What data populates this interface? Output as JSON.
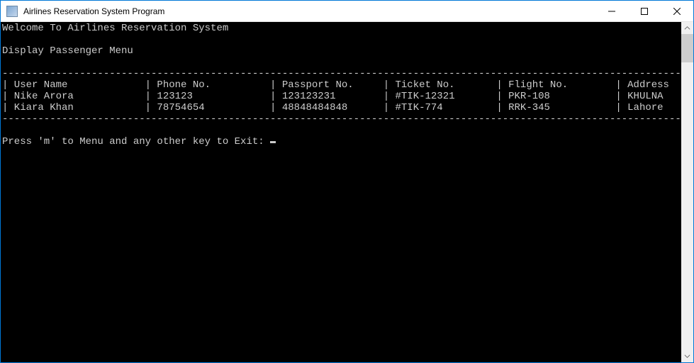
{
  "window": {
    "title": "Airlines Reservation System Program"
  },
  "console": {
    "welcome": "Welcome To Airlines Reservation System",
    "menu_header": "Display Passenger Menu",
    "divider": "-----------------------------------------------------------------------------------------------------------------------",
    "columns": {
      "user_name": "User Name",
      "phone_no": "Phone No.",
      "passport_no": "Passport No.",
      "ticket_no": "Ticket No.",
      "flight_no": "Flight No.",
      "address": "Address"
    },
    "rows": [
      {
        "user_name": "Nike Arora",
        "phone_no": "123123",
        "passport_no": "123123231",
        "ticket_no": "#TIK-12321",
        "flight_no": "PKR-108",
        "address": "KHULNA"
      },
      {
        "user_name": "Kiara Khan",
        "phone_no": "78754654",
        "passport_no": "48848484848",
        "ticket_no": "#TIK-774",
        "flight_no": "RRK-345",
        "address": "Lahore"
      }
    ],
    "prompt": "Press 'm' to Menu and any other key to Exit: "
  }
}
